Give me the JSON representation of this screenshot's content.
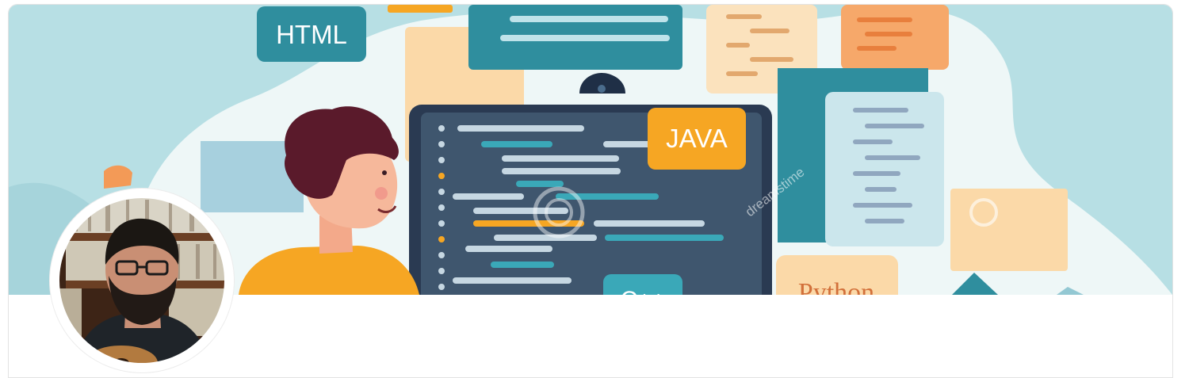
{
  "profile": {
    "cover": {
      "alt": "Developer coding illustration",
      "badges": {
        "html": "HTML",
        "java": "JAVA",
        "cpp": "C++",
        "python": "Python"
      },
      "watermark": "dreamstime"
    },
    "avatar": {
      "alt": "Profile photo"
    }
  },
  "colors": {
    "cover_bg": "#b7dfe4",
    "teal": "#2f8e9e",
    "orange": "#f6a623",
    "peach": "#fbd9a8",
    "navy": "#33475b"
  }
}
